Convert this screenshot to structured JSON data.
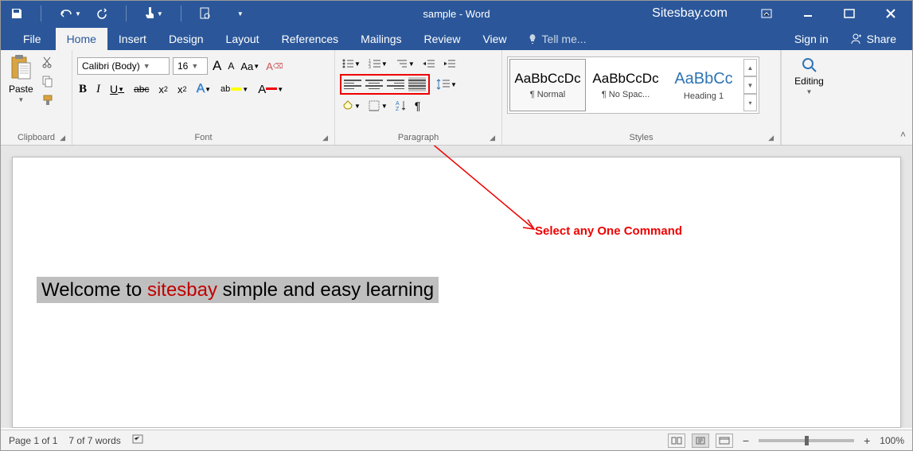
{
  "titlebar": {
    "title": "sample - Word",
    "site": "Sitesbay.com"
  },
  "tabs": {
    "file": "File",
    "home": "Home",
    "insert": "Insert",
    "design": "Design",
    "layout": "Layout",
    "references": "References",
    "mailings": "Mailings",
    "review": "Review",
    "view": "View",
    "tellme": "Tell me...",
    "signin": "Sign in",
    "share": "Share"
  },
  "ribbon": {
    "clipboard": {
      "paste": "Paste",
      "label": "Clipboard"
    },
    "font": {
      "name": "Calibri (Body)",
      "size": "16",
      "label": "Font",
      "bold": "B",
      "italic": "I",
      "underline": "U",
      "strike": "abc",
      "sub": "x",
      "sup": "x",
      "grow": "A",
      "shrink": "A",
      "case": "Aa",
      "clear": "A"
    },
    "paragraph": {
      "label": "Paragraph"
    },
    "styles": {
      "label": "Styles",
      "items": [
        {
          "preview": "AaBbCcDc",
          "name": "¶ Normal",
          "color": "#222"
        },
        {
          "preview": "AaBbCcDc",
          "name": "¶ No Spac...",
          "color": "#222"
        },
        {
          "preview": "AaBbCc",
          "name": "Heading 1",
          "color": "#2e74b5"
        }
      ]
    },
    "editing": {
      "label": "Editing"
    }
  },
  "annotation": "Select any One Command",
  "doc": {
    "prefix": "Welcome to ",
    "highlight": "sitesbay",
    "suffix": " simple and easy learning"
  },
  "status": {
    "page": "Page 1 of 1",
    "words": "7 of 7 words",
    "zoom": "100%"
  }
}
